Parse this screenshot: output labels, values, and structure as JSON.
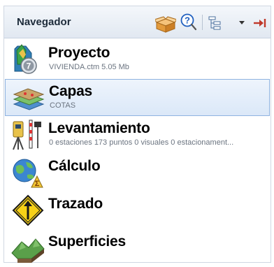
{
  "navigator": {
    "title": "Navegador",
    "items": [
      {
        "label": "Proyecto",
        "subtitle": "VIVIENDA.ctm 5.05 Mb",
        "icon": "project-icon"
      },
      {
        "label": "Capas",
        "subtitle": "COTAS",
        "icon": "layers-icon",
        "selected": true
      },
      {
        "label": "Levantamiento",
        "subtitle": "0 estaciones 173 puntos 0 visuales 0 estacionament...",
        "icon": "survey-total-station-icon"
      },
      {
        "label": "Cálculo",
        "subtitle": "",
        "icon": "calculation-globe-icon"
      },
      {
        "label": "Trazado",
        "subtitle": "",
        "icon": "road-sign-icon"
      },
      {
        "label": "Superficies",
        "subtitle": "",
        "icon": "terrain-surface-icon"
      }
    ]
  },
  "toolbar": {
    "icons": [
      "package-icon",
      "help-icon",
      "tree-view-icon",
      "dropdown-arrow-icon",
      "pin-right-icon"
    ]
  },
  "colors": {
    "selection_border": "#8fb3e0",
    "selection_fill": "#dbe8f8",
    "header_fill": "#e1e8f1",
    "pin_arrow": "#c0392b",
    "help_icon": "#1f5fbf"
  }
}
